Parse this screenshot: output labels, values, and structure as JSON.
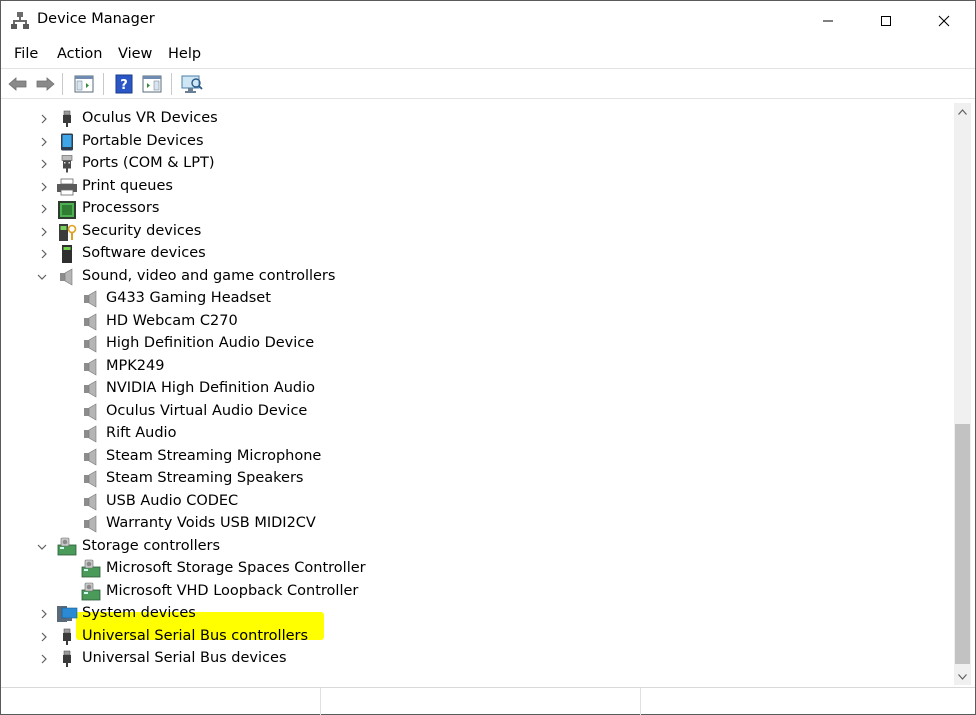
{
  "window": {
    "title": "Device Manager"
  },
  "menu": {
    "file": "File",
    "action": "Action",
    "view": "View",
    "help": "Help"
  },
  "toolbar": {
    "buttons": [
      "back-icon",
      "forward-icon",
      "show-hide-console-tree-icon",
      "help-icon",
      "properties-icon",
      "scan-hardware-icon"
    ]
  },
  "tree": {
    "oculus": "Oculus VR Devices",
    "portable": "Portable Devices",
    "ports": "Ports (COM & LPT)",
    "print": "Print queues",
    "processors": "Processors",
    "security": "Security devices",
    "software": "Software devices",
    "sound": "Sound, video and game controllers",
    "sound_children": [
      "G433 Gaming Headset",
      "HD Webcam C270",
      "High Definition Audio Device",
      "MPK249",
      "NVIDIA High Definition Audio",
      "Oculus Virtual Audio Device",
      "Rift Audio",
      "Steam Streaming Microphone",
      "Steam Streaming Speakers",
      "USB Audio CODEC",
      "Warranty Voids USB MIDI2CV"
    ],
    "storage": "Storage controllers",
    "storage_children": [
      "Microsoft Storage Spaces Controller",
      "Microsoft VHD Loopback Controller"
    ],
    "system": "System devices",
    "usb_controllers": "Universal Serial Bus controllers",
    "usb_devices": "Universal Serial Bus devices"
  },
  "colors": {
    "highlight": "#ffff00",
    "scroll_thumb": "#c2c2c2",
    "chevron": "#606060"
  }
}
